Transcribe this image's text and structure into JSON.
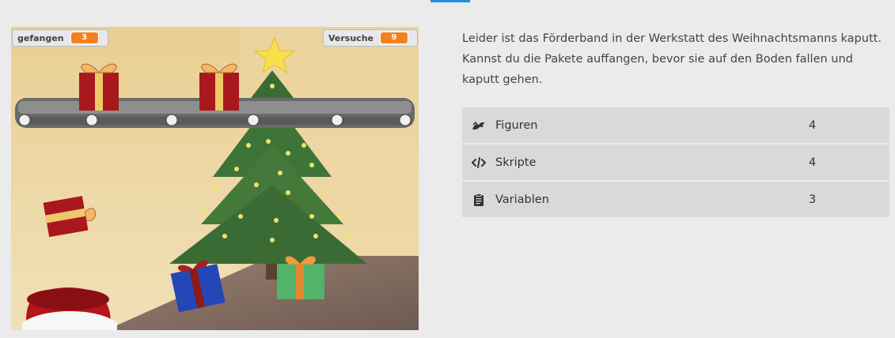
{
  "stage": {
    "monitors": [
      {
        "label": "gefangen",
        "value": "3"
      },
      {
        "label": "Versuche",
        "value": "9"
      }
    ]
  },
  "description": "Leider ist das Förderband in der Werkstatt des Weihnachtsmanns kaputt. Kannst du die Pakete auffangen, bevor sie auf den Boden fallen und kaputt gehen.",
  "stats": [
    {
      "icon": "figures-icon",
      "label": "Figuren",
      "value": "4"
    },
    {
      "icon": "code-icon",
      "label": "Skripte",
      "value": "4"
    },
    {
      "icon": "clipboard-icon",
      "label": "Variablen",
      "value": "3"
    }
  ],
  "colors": {
    "accent": "#1e90e0",
    "monitor_value": "#f3821e",
    "stat_row": "#d9d9d9"
  }
}
